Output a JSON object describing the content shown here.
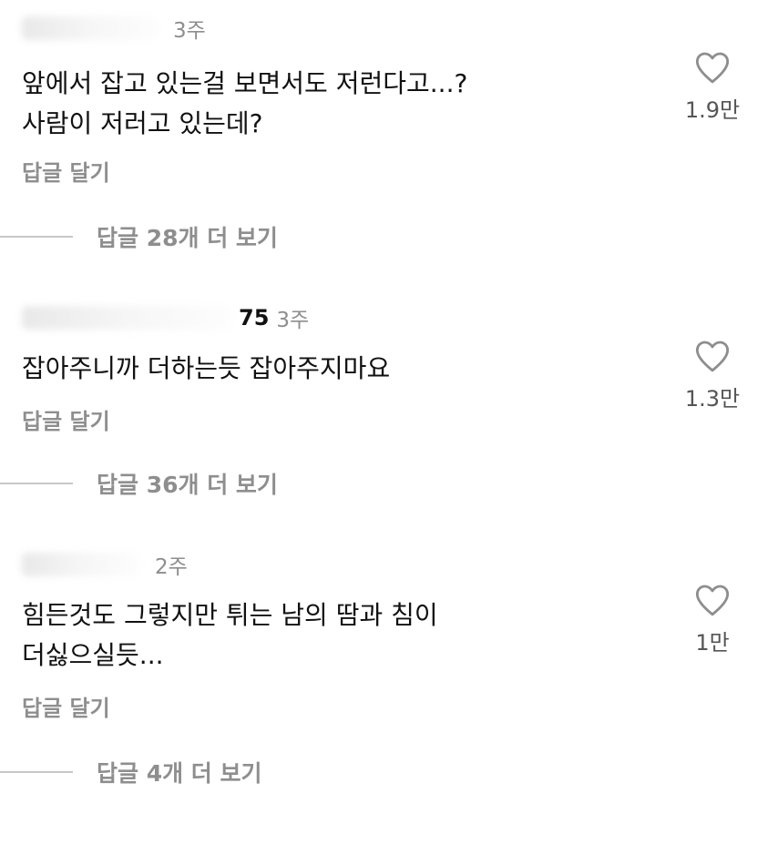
{
  "comments": [
    {
      "username_visible": "",
      "timestamp": "3주",
      "body": "앞에서 잡고 있는걸 보면서도 저런다고...?\n사람이 저러고 있는데?",
      "reply_label": "답글 달기",
      "likes": "1.9만",
      "view_replies": "답글 28개 더 보기"
    },
    {
      "username_visible": "75",
      "timestamp": "3주",
      "body": "잡아주니까 더하는듯 잡아주지마요",
      "reply_label": "답글 달기",
      "likes": "1.3만",
      "view_replies": "답글 36개 더 보기"
    },
    {
      "username_visible": "",
      "timestamp": "2주",
      "body": "힘든것도 그렇지만 튀는 남의 땀과 침이\n더싫으실듯...",
      "reply_label": "답글 달기",
      "likes": "1만",
      "view_replies": "답글 4개 더 보기"
    }
  ],
  "icons": {
    "like": "heart-outline-icon"
  },
  "colors": {
    "text_primary": "#111111",
    "text_secondary": "#8e8e8e",
    "divider": "#c7c7c7"
  }
}
